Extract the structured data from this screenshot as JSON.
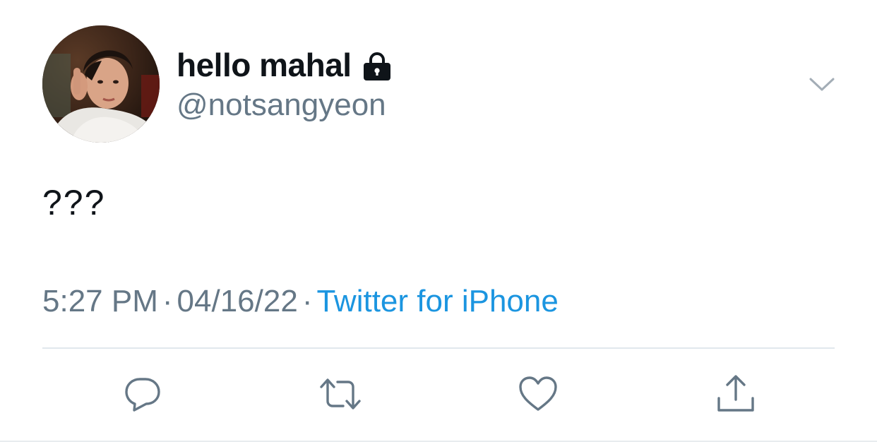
{
  "tweet": {
    "display_name": "hello mahal",
    "handle": "@notsangyeon",
    "text": "???",
    "time": "5:27 PM",
    "date": "04/16/22",
    "separator": "·",
    "source": "Twitter for iPhone",
    "protected_icon": "lock-icon",
    "menu_icon": "chevron-down-icon"
  },
  "actions": [
    {
      "name": "reply",
      "icon": "reply-icon"
    },
    {
      "name": "retweet",
      "icon": "retweet-icon"
    },
    {
      "name": "like",
      "icon": "heart-icon"
    },
    {
      "name": "share",
      "icon": "share-icon"
    }
  ],
  "colors": {
    "text_primary": "#0f1419",
    "text_secondary": "#657786",
    "link": "#1b95e0",
    "divider": "#e1e8ed"
  }
}
